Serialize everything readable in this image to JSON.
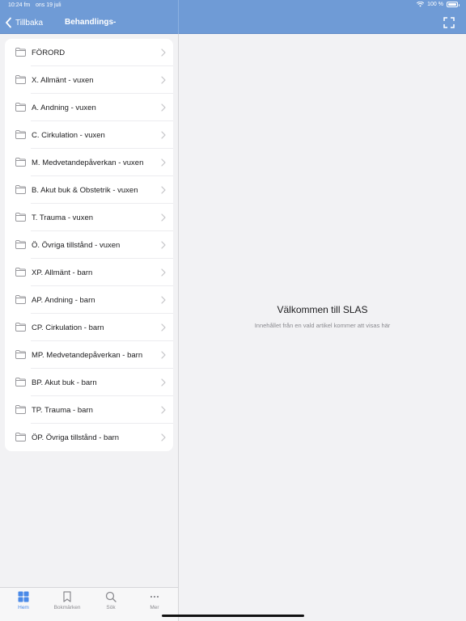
{
  "status": {
    "time": "10:24 fm",
    "date": "ons 19 juli",
    "battery": "100 %"
  },
  "nav": {
    "back_label": "Tillbaka",
    "title": "Behandlings-"
  },
  "menu": {
    "items": [
      {
        "label": "FÖRORD"
      },
      {
        "label": "X. Allmänt - vuxen"
      },
      {
        "label": "A. Andning - vuxen"
      },
      {
        "label": "C. Cirkulation - vuxen"
      },
      {
        "label": "M. Medvetandepåverkan - vuxen"
      },
      {
        "label": "B. Akut buk & Obstetrik - vuxen"
      },
      {
        "label": "T. Trauma - vuxen"
      },
      {
        "label": "Ö. Övriga tillstånd - vuxen"
      },
      {
        "label": "XP. Allmänt - barn"
      },
      {
        "label": "AP. Andning - barn"
      },
      {
        "label": "CP. Cirkulation - barn"
      },
      {
        "label": "MP. Medvetandepåverkan - barn"
      },
      {
        "label": "BP. Akut buk - barn"
      },
      {
        "label": "TP. Trauma - barn"
      },
      {
        "label": "ÖP. Övriga tillstånd - barn"
      }
    ]
  },
  "detail": {
    "title": "Välkommen till SLAS",
    "subtitle": "Innehållet från en vald artikel kommer att visas här"
  },
  "tabs": {
    "home": "Hem",
    "bookmarks": "Bokmärken",
    "search": "Sök",
    "more": "Mer"
  },
  "colors": {
    "header": "#6f9bd6",
    "accent": "#4a8ae8",
    "background": "#f2f2f4"
  }
}
